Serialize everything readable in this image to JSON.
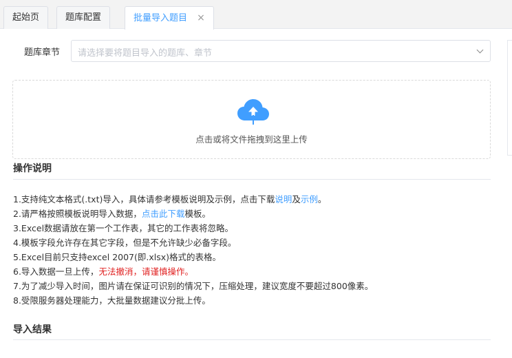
{
  "tabs": [
    {
      "label": "起始页"
    },
    {
      "label": "题库配置"
    },
    {
      "label": "批量导入题目",
      "close": "×"
    }
  ],
  "form": {
    "chapter_label": "题库章节",
    "chapter_placeholder": "请选择要将题目导入的题库、章节"
  },
  "upload": {
    "icon": "cloud-upload-icon",
    "hint": "点击或将文件拖拽到这里上传"
  },
  "instructions": {
    "title": "操作说明",
    "items": [
      {
        "parts": [
          "1.支持纯文本格式(.txt)导入，具体请参考模板说明及示例，点击下载",
          "说明",
          "及",
          "示例",
          "。"
        ]
      },
      {
        "parts": [
          "2.请严格按照模板说明导入数据，",
          "点击此下载",
          "模板。"
        ]
      },
      {
        "parts": [
          "3.Excel数据请放在第一个工作表，其它的工作表将忽略。"
        ]
      },
      {
        "parts": [
          "4.模板字段允许存在其它字段，但是不允许缺少必备字段。"
        ]
      },
      {
        "parts": [
          "5.Excel目前只支持excel 2007(即.xlsx)格式的表格。"
        ]
      },
      {
        "parts": [
          "6.导入数据一旦上传，",
          "无法撤消，请谨慎操作。"
        ]
      },
      {
        "parts": [
          "7.为了减少导入时间，图片请在保证可识别的情况下，压缩处理，建议宽度不要超过800像素。"
        ]
      },
      {
        "parts": [
          "8.受限服务器处理能力，大批量数据建议分批上传。"
        ]
      }
    ]
  },
  "result": {
    "title": "导入结果"
  },
  "colors": {
    "accent": "#409eff",
    "warning": "#e02020"
  }
}
